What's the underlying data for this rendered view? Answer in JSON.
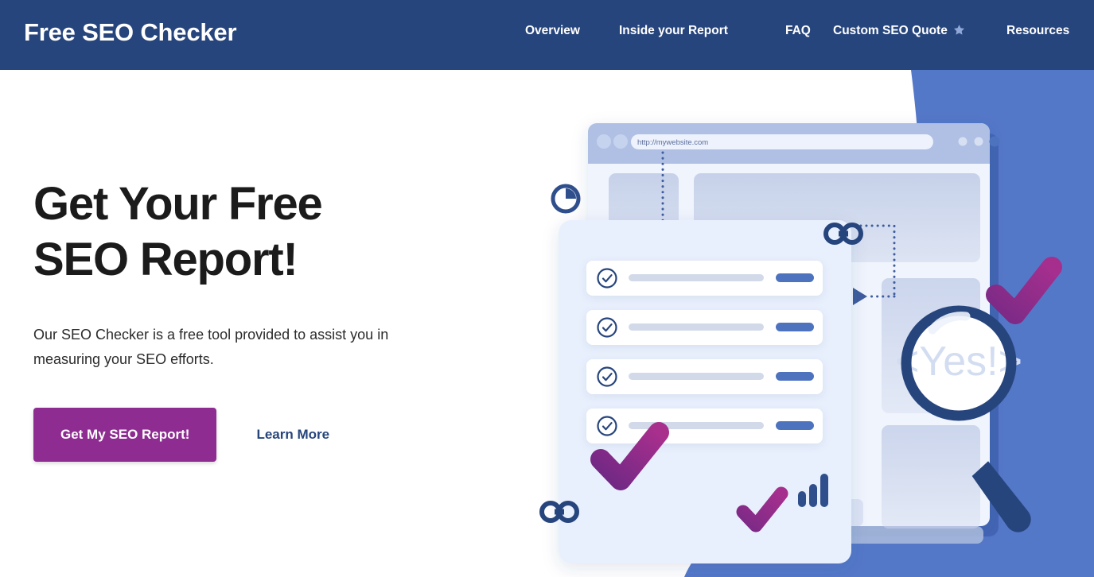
{
  "header": {
    "brand": "Free SEO Checker",
    "nav": [
      {
        "label": "Overview",
        "icon": null
      },
      {
        "label": "Inside your Report",
        "icon": null
      },
      {
        "label": "FAQ",
        "icon": null
      },
      {
        "label": "Custom SEO Quote",
        "icon": "star-icon"
      },
      {
        "label": "Resources",
        "icon": null
      }
    ]
  },
  "hero": {
    "title_line1": "Get Your Free",
    "title_line2": "SEO Report!",
    "subtitle": "Our SEO Checker is a free tool provided to assist you in measuring your SEO efforts.",
    "cta_label": "Get My SEO Report!",
    "secondary_label": "Learn More"
  },
  "illustration": {
    "browser_url": "http://mywebsite.com",
    "magnifier_text": "<Yes!>",
    "checklist_rows": 4,
    "icons": [
      "clock-icon",
      "link-icon-top",
      "link-icon-bottom",
      "bar-chart-icon",
      "check-mark-top-right",
      "check-mark-center",
      "check-mark-bottom",
      "magnifier-icon",
      "arrow-marker-icon"
    ]
  },
  "colors": {
    "header_navy": "#27457D",
    "accent_purple": "#8E2C92",
    "accent_purple_dark": "#7B2A86",
    "bg_blue": "#5478C8",
    "bg_blue_shadow": "#4465B4",
    "panel_light": "#EDF2FC",
    "panel_mid": "#C9D4EC",
    "pill_blue": "#4E73BE",
    "bar_gray": "#D2DAEA",
    "text_dark": "#1b1b1b",
    "link_navy": "#27457D",
    "star_blue": "#8FA8D8",
    "magnifier_ring": "#27457D"
  }
}
